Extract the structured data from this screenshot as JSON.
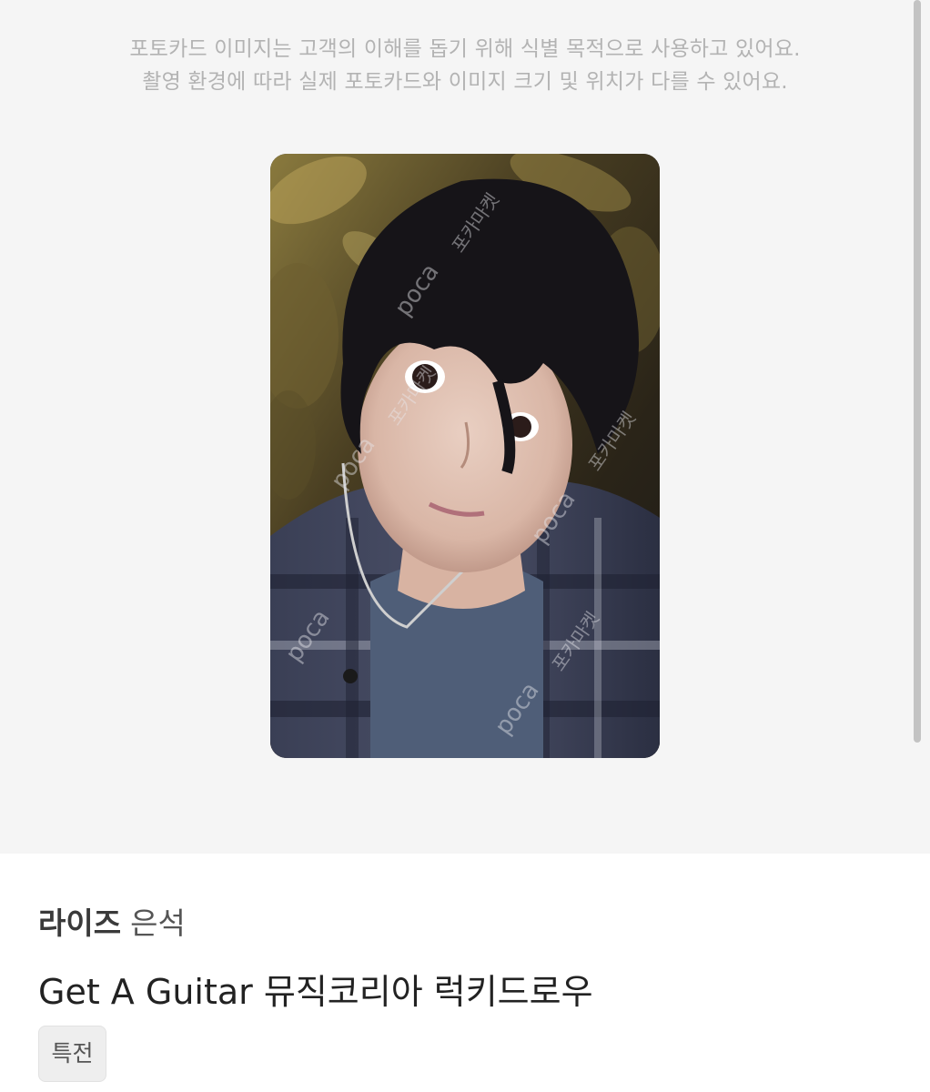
{
  "notice": {
    "line1": "포토카드 이미지는 고객의 이해를 돕기 위해 식별 목적으로 사용하고 있어요.",
    "line2": "촬영 환경에 따라 실제 포토카드와 이미지 크기 및 위치가 다를 수 있어요."
  },
  "photocard": {
    "watermark_latin": "poca",
    "watermark_korean": "포카마켓"
  },
  "product": {
    "group": "라이즈",
    "member": "은석",
    "title": "Get A Guitar 뮤직코리아 럭키드로우",
    "badge": "특전"
  }
}
